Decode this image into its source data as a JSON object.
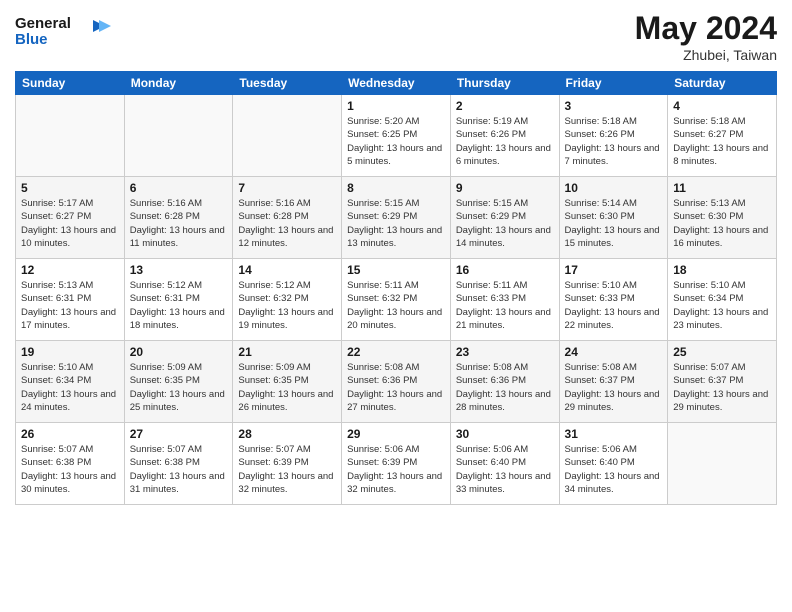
{
  "logo": {
    "line1": "General",
    "line2": "Blue"
  },
  "title": "May 2024",
  "location": "Zhubei, Taiwan",
  "days_header": [
    "Sunday",
    "Monday",
    "Tuesday",
    "Wednesday",
    "Thursday",
    "Friday",
    "Saturday"
  ],
  "weeks": [
    [
      {
        "num": "",
        "sunrise": "",
        "sunset": "",
        "daylight": ""
      },
      {
        "num": "",
        "sunrise": "",
        "sunset": "",
        "daylight": ""
      },
      {
        "num": "",
        "sunrise": "",
        "sunset": "",
        "daylight": ""
      },
      {
        "num": "1",
        "sunrise": "Sunrise: 5:20 AM",
        "sunset": "Sunset: 6:25 PM",
        "daylight": "Daylight: 13 hours and 5 minutes."
      },
      {
        "num": "2",
        "sunrise": "Sunrise: 5:19 AM",
        "sunset": "Sunset: 6:26 PM",
        "daylight": "Daylight: 13 hours and 6 minutes."
      },
      {
        "num": "3",
        "sunrise": "Sunrise: 5:18 AM",
        "sunset": "Sunset: 6:26 PM",
        "daylight": "Daylight: 13 hours and 7 minutes."
      },
      {
        "num": "4",
        "sunrise": "Sunrise: 5:18 AM",
        "sunset": "Sunset: 6:27 PM",
        "daylight": "Daylight: 13 hours and 8 minutes."
      }
    ],
    [
      {
        "num": "5",
        "sunrise": "Sunrise: 5:17 AM",
        "sunset": "Sunset: 6:27 PM",
        "daylight": "Daylight: 13 hours and 10 minutes."
      },
      {
        "num": "6",
        "sunrise": "Sunrise: 5:16 AM",
        "sunset": "Sunset: 6:28 PM",
        "daylight": "Daylight: 13 hours and 11 minutes."
      },
      {
        "num": "7",
        "sunrise": "Sunrise: 5:16 AM",
        "sunset": "Sunset: 6:28 PM",
        "daylight": "Daylight: 13 hours and 12 minutes."
      },
      {
        "num": "8",
        "sunrise": "Sunrise: 5:15 AM",
        "sunset": "Sunset: 6:29 PM",
        "daylight": "Daylight: 13 hours and 13 minutes."
      },
      {
        "num": "9",
        "sunrise": "Sunrise: 5:15 AM",
        "sunset": "Sunset: 6:29 PM",
        "daylight": "Daylight: 13 hours and 14 minutes."
      },
      {
        "num": "10",
        "sunrise": "Sunrise: 5:14 AM",
        "sunset": "Sunset: 6:30 PM",
        "daylight": "Daylight: 13 hours and 15 minutes."
      },
      {
        "num": "11",
        "sunrise": "Sunrise: 5:13 AM",
        "sunset": "Sunset: 6:30 PM",
        "daylight": "Daylight: 13 hours and 16 minutes."
      }
    ],
    [
      {
        "num": "12",
        "sunrise": "Sunrise: 5:13 AM",
        "sunset": "Sunset: 6:31 PM",
        "daylight": "Daylight: 13 hours and 17 minutes."
      },
      {
        "num": "13",
        "sunrise": "Sunrise: 5:12 AM",
        "sunset": "Sunset: 6:31 PM",
        "daylight": "Daylight: 13 hours and 18 minutes."
      },
      {
        "num": "14",
        "sunrise": "Sunrise: 5:12 AM",
        "sunset": "Sunset: 6:32 PM",
        "daylight": "Daylight: 13 hours and 19 minutes."
      },
      {
        "num": "15",
        "sunrise": "Sunrise: 5:11 AM",
        "sunset": "Sunset: 6:32 PM",
        "daylight": "Daylight: 13 hours and 20 minutes."
      },
      {
        "num": "16",
        "sunrise": "Sunrise: 5:11 AM",
        "sunset": "Sunset: 6:33 PM",
        "daylight": "Daylight: 13 hours and 21 minutes."
      },
      {
        "num": "17",
        "sunrise": "Sunrise: 5:10 AM",
        "sunset": "Sunset: 6:33 PM",
        "daylight": "Daylight: 13 hours and 22 minutes."
      },
      {
        "num": "18",
        "sunrise": "Sunrise: 5:10 AM",
        "sunset": "Sunset: 6:34 PM",
        "daylight": "Daylight: 13 hours and 23 minutes."
      }
    ],
    [
      {
        "num": "19",
        "sunrise": "Sunrise: 5:10 AM",
        "sunset": "Sunset: 6:34 PM",
        "daylight": "Daylight: 13 hours and 24 minutes."
      },
      {
        "num": "20",
        "sunrise": "Sunrise: 5:09 AM",
        "sunset": "Sunset: 6:35 PM",
        "daylight": "Daylight: 13 hours and 25 minutes."
      },
      {
        "num": "21",
        "sunrise": "Sunrise: 5:09 AM",
        "sunset": "Sunset: 6:35 PM",
        "daylight": "Daylight: 13 hours and 26 minutes."
      },
      {
        "num": "22",
        "sunrise": "Sunrise: 5:08 AM",
        "sunset": "Sunset: 6:36 PM",
        "daylight": "Daylight: 13 hours and 27 minutes."
      },
      {
        "num": "23",
        "sunrise": "Sunrise: 5:08 AM",
        "sunset": "Sunset: 6:36 PM",
        "daylight": "Daylight: 13 hours and 28 minutes."
      },
      {
        "num": "24",
        "sunrise": "Sunrise: 5:08 AM",
        "sunset": "Sunset: 6:37 PM",
        "daylight": "Daylight: 13 hours and 29 minutes."
      },
      {
        "num": "25",
        "sunrise": "Sunrise: 5:07 AM",
        "sunset": "Sunset: 6:37 PM",
        "daylight": "Daylight: 13 hours and 29 minutes."
      }
    ],
    [
      {
        "num": "26",
        "sunrise": "Sunrise: 5:07 AM",
        "sunset": "Sunset: 6:38 PM",
        "daylight": "Daylight: 13 hours and 30 minutes."
      },
      {
        "num": "27",
        "sunrise": "Sunrise: 5:07 AM",
        "sunset": "Sunset: 6:38 PM",
        "daylight": "Daylight: 13 hours and 31 minutes."
      },
      {
        "num": "28",
        "sunrise": "Sunrise: 5:07 AM",
        "sunset": "Sunset: 6:39 PM",
        "daylight": "Daylight: 13 hours and 32 minutes."
      },
      {
        "num": "29",
        "sunrise": "Sunrise: 5:06 AM",
        "sunset": "Sunset: 6:39 PM",
        "daylight": "Daylight: 13 hours and 32 minutes."
      },
      {
        "num": "30",
        "sunrise": "Sunrise: 5:06 AM",
        "sunset": "Sunset: 6:40 PM",
        "daylight": "Daylight: 13 hours and 33 minutes."
      },
      {
        "num": "31",
        "sunrise": "Sunrise: 5:06 AM",
        "sunset": "Sunset: 6:40 PM",
        "daylight": "Daylight: 13 hours and 34 minutes."
      },
      {
        "num": "",
        "sunrise": "",
        "sunset": "",
        "daylight": ""
      }
    ]
  ]
}
